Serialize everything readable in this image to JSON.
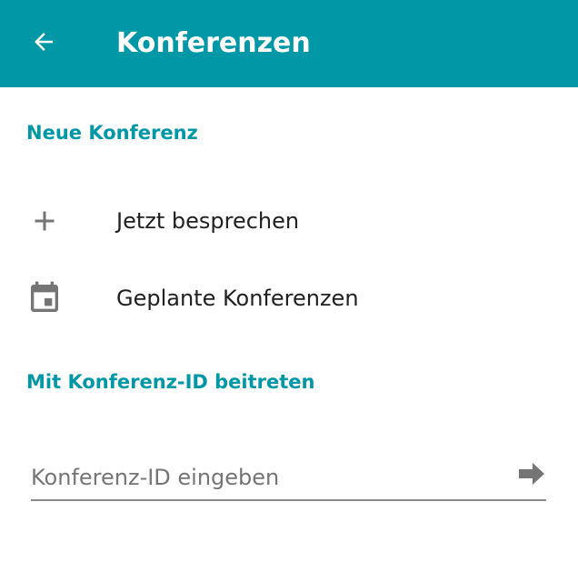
{
  "app_bar": {
    "title": "Konferenzen",
    "back_icon": "arrow-left-icon",
    "background_color": "#0097a7",
    "title_color": "#ffffff"
  },
  "new_conference": {
    "header": "Neue Konferenz",
    "items": [
      {
        "label": "Jetzt besprechen",
        "icon": "plus-icon"
      },
      {
        "label": "Geplante Konferenzen",
        "icon": "calendar-icon"
      }
    ]
  },
  "join": {
    "header": "Mit Konferenz-ID beitreten",
    "input_value": "",
    "input_placeholder": "Konferenz-ID eingeben",
    "submit_icon": "arrow-right-icon"
  },
  "colors": {
    "accent": "#0097a7",
    "icon_gray": "#757575",
    "text": "#212121"
  }
}
